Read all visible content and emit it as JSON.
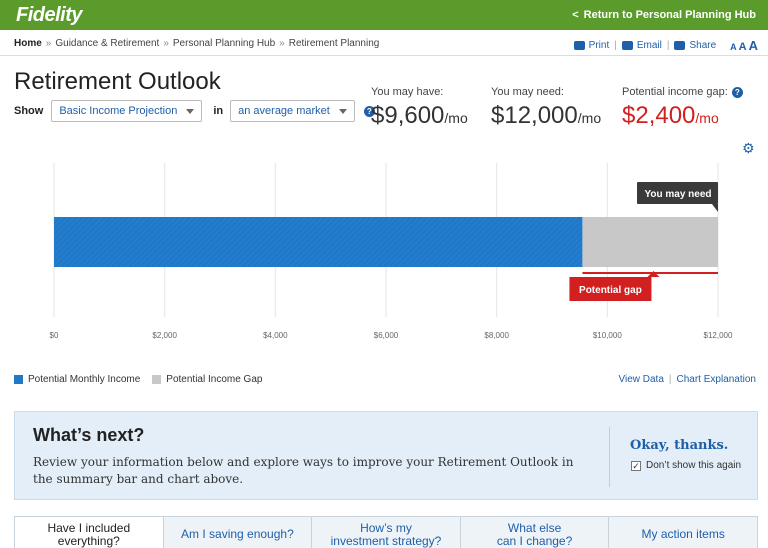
{
  "header": {
    "logo": "Fidelity",
    "return_chevron": "<",
    "return_link": "Return to Personal Planning Hub"
  },
  "breadcrumb": {
    "items": [
      "Home",
      "Guidance & Retirement",
      "Personal Planning Hub",
      "Retirement Planning"
    ],
    "separator": "»"
  },
  "utilities": {
    "print": "Print",
    "email": "Email",
    "share": "Share",
    "text_size": [
      "A",
      "A",
      "A"
    ],
    "icons": [
      "printer-icon",
      "envelope-icon",
      "share-icon"
    ]
  },
  "page": {
    "title": "Retirement Outlook",
    "show_label": "Show",
    "projection_value": "Basic Income Projection",
    "in_label": "in",
    "market_value": "an average market",
    "help_glyph": "?"
  },
  "metrics": {
    "may_have_label": "You may have:",
    "may_have_value": "$9,600",
    "may_need_label": "You may need:",
    "may_need_value": "$12,000",
    "gap_label": "Potential income gap:",
    "gap_value": "$2,400",
    "unit": "/mo"
  },
  "chart_data": {
    "type": "bar",
    "orientation": "horizontal",
    "categories": [
      ""
    ],
    "series": [
      {
        "name": "Potential Monthly Income",
        "values": [
          9550
        ],
        "color": "#1f78c8"
      },
      {
        "name": "Potential Income Gap",
        "values": [
          2450
        ],
        "color": "#c8c8c8"
      }
    ],
    "stacked": true,
    "xlim": [
      0,
      12000
    ],
    "tick_labels": [
      "$0",
      "$2,000",
      "$4,000",
      "$6,000",
      "$8,000",
      "$10,000",
      "$12,000"
    ],
    "tick_values": [
      0,
      2000,
      4000,
      6000,
      8000,
      10000,
      12000
    ],
    "grid": true,
    "annotations": [
      {
        "text": "You may need",
        "at": 12000,
        "color": "#3a3a3a"
      },
      {
        "text": "Potential gap",
        "from": 9550,
        "to": 12000,
        "color": "#d21f1f"
      }
    ],
    "legend": [
      "Potential Monthly Income",
      "Potential Income Gap"
    ],
    "legend_position": "bottom-left"
  },
  "links": {
    "view_data": "View Data",
    "chart_explanation": "Chart Explanation"
  },
  "next_panel": {
    "title": "What’s next?",
    "body": "Review your information below and explore ways to improve your Retirement Outlook in the summary bar and chart above.",
    "okay": "Okay, thanks.",
    "dont_show": "Don’t show this again",
    "checked": true,
    "check_glyph": "✓"
  },
  "tabs": [
    {
      "line1": "Have I included",
      "line2": "everything?"
    },
    {
      "line1": "Am I saving enough?",
      "line2": ""
    },
    {
      "line1": "How’s my",
      "line2": "investment strategy?"
    },
    {
      "line1": "What else",
      "line2": "can I change?"
    },
    {
      "line1": "My action items",
      "line2": ""
    }
  ],
  "colors": {
    "brand_green": "#5b9b2b",
    "link_blue": "#1f5fa8",
    "gap_red": "#d21f1f"
  }
}
